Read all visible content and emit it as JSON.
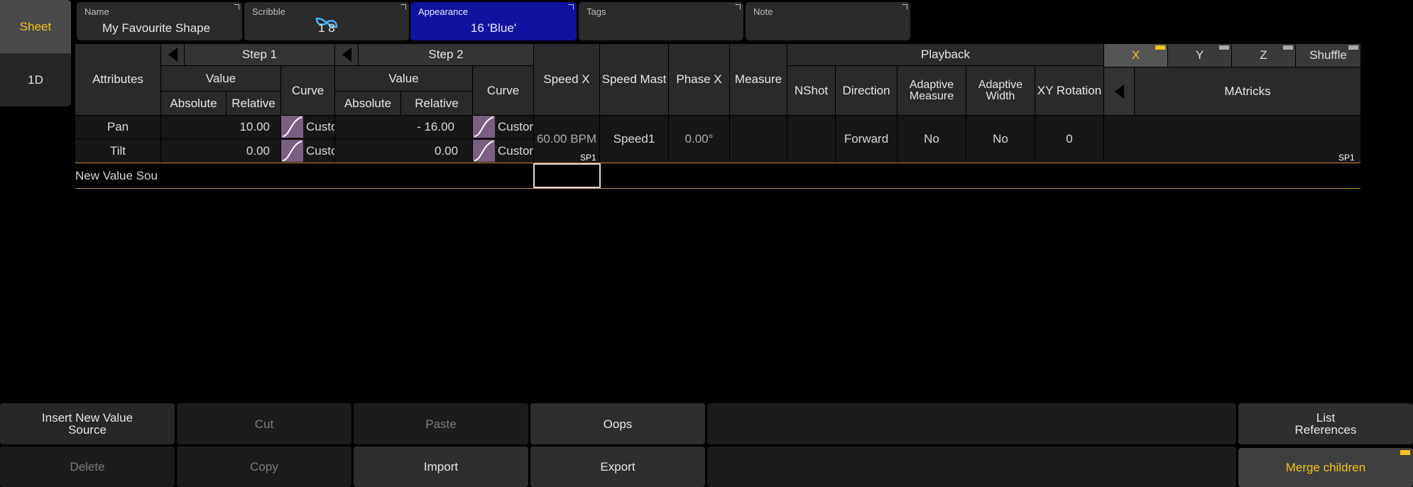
{
  "left_tabs": [
    "Sheet",
    "1D"
  ],
  "header": {
    "name_label": "Name",
    "name_value": "My Favourite Shape",
    "scribble_label": "Scribble",
    "scribble_value": "1 8",
    "appearance_label": "Appearance",
    "appearance_value": "16 'Blue'",
    "tags_label": "Tags",
    "tags_value": "",
    "note_label": "Note",
    "note_value": ""
  },
  "table": {
    "attributes_header": "Attributes",
    "step1": "Step 1",
    "step2": "Step 2",
    "value": "Value",
    "absolute": "Absolute",
    "relative": "Relative",
    "curve": "Curve",
    "speed_x": "Speed X",
    "speed_master": "Speed Mast",
    "phase_x": "Phase X",
    "measure": "Measure",
    "playback": "Playback",
    "nshot": "NShot",
    "direction": "Direction",
    "adaptive_measure": "Adaptive Measure",
    "adaptive_width": "Adaptive Width",
    "xy_rotation": "XY Rotation",
    "matricks": "MAtricks",
    "matricks_tabs": [
      "X",
      "Y",
      "Z",
      "Shuffle"
    ],
    "rows": [
      {
        "attribute": "Pan",
        "s1_relative": "10.00",
        "s1_curve": "Custo",
        "s2_relative": "- 16.00",
        "s2_curve": "Custor"
      },
      {
        "attribute": "Tilt",
        "s1_relative": "0.00",
        "s1_curve": "Custo",
        "s2_relative": "0.00",
        "s2_curve": "Custor"
      }
    ],
    "speed_x_value": "60.00 BPM",
    "speed_x_tag": "SP1",
    "speed_master_value": "Speed1",
    "phase_x_value": "0.00°",
    "direction_value": "Forward",
    "adaptive_measure_value": "No",
    "adaptive_width_value": "No",
    "xy_rotation_value": "0",
    "matricks_tag": "SP1",
    "new_value_source": "New Value Sou"
  },
  "buttons": {
    "insert": "Insert New Value Source",
    "cut": "Cut",
    "paste": "Paste",
    "oops": "Oops",
    "list_references": "List References",
    "delete": "Delete",
    "copy": "Copy",
    "import": "Import",
    "export": "Export",
    "merge_children": "Merge children"
  },
  "colors": {
    "accent": "#f3c21b",
    "appearance": "#1212a0",
    "curve": "#7a5f82"
  }
}
